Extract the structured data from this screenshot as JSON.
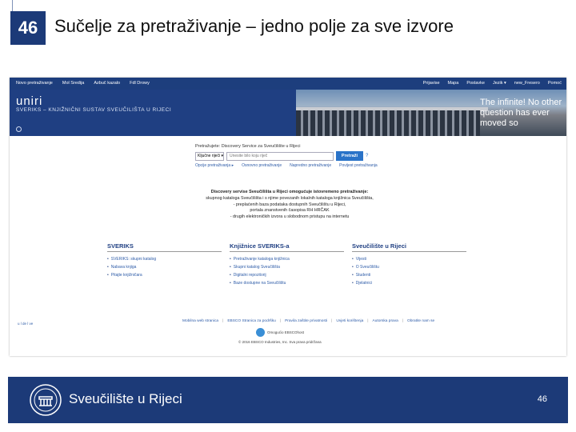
{
  "slide": {
    "number": "46",
    "title": "Sučelje za pretraživanje – jedno polje za sve izvore",
    "page_number": "46",
    "university": "Sveučilište u Rijeci"
  },
  "topnav": {
    "left": [
      "Novo pretraživanje",
      "Mol Sredija",
      "Azbuč kazalo",
      "Fdl Drowy"
    ],
    "right": [
      "Prijavise",
      "Mapa",
      "Postavke",
      "Jezik ▾",
      "new_Fresero",
      "Pomoć"
    ]
  },
  "banner": {
    "logo": "uniri",
    "subtitle": "SVERIKS – KNJIŽNIČNI SUSTAV SVEUČILIŠTA U RIJECI",
    "quote": "The infinite! No other question has ever moved so"
  },
  "search": {
    "label": "Pretražujete: Discovery Service za Sveučilište u Rijeci",
    "select_value": "Ključne riječi",
    "placeholder": "Unesite bilo koju riječ",
    "button": "Pretraži",
    "help": "?",
    "options": [
      "Opcije pretraživanja ▸",
      "Osnovno pretraživanje",
      "Napredno pretraživanje",
      "Povijest pretraživanja"
    ]
  },
  "info": {
    "heading": "Discovery servise Sveučilišta u Rijeci omogućuje istovremeno pretraživanje:",
    "lines": [
      "skupnog kataloga Sveučilišta i s njime povezanih lokalnih kataloga knjižnica Sveučilišta,",
      "- preplaćenih baza podataka dostupnih Sveučilištu u Rijeci,",
      "portala znanstvenih časopisa RH HRČAK",
      "- drugih elektroničkih izvora u slobodnom pristupu na internetu"
    ]
  },
  "columns": [
    {
      "title": "SVERIKS",
      "items": [
        "SVERIKS: skupni katalog",
        "Nabava knjiga",
        "Pitajte knjižničara"
      ]
    },
    {
      "title": "Knjižnice SVERIKS-a",
      "items": [
        "Pretraživanje kataloga knjižnica",
        "Skupni katalog Sveučilišta",
        "Digitalni repozitorij",
        "Baze dostupne na Sveučilištu"
      ]
    },
    {
      "title": "Sveučilište u Rijeci",
      "items": [
        "Vijesti",
        "O Sveučilištu",
        "Studenti",
        "Djelatnici"
      ]
    }
  ],
  "footer": {
    "left": "u l de l ve",
    "links": [
      "Mobilna web stranica",
      "EBSCO Stranica za podršku",
      "Pravila zaštite privatnosti",
      "Uvjeti korištenja",
      "Autorska prava",
      "Obratite nam se"
    ],
    "ebsco": "Omogućio EBSCOhost",
    "copyright": "© 2016 EBSCO Industries, Inc. Sva prava pridržana"
  }
}
